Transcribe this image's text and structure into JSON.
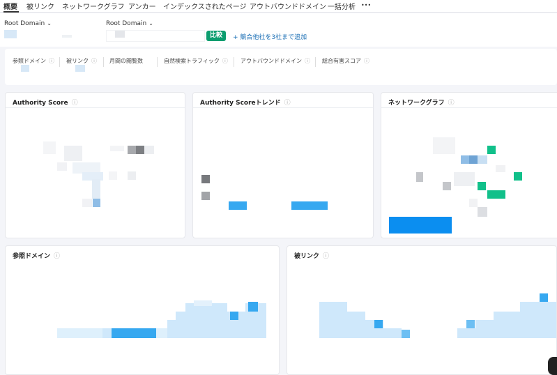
{
  "tabs": [
    "概要",
    "被リンク",
    "ネットワークグラフ",
    "アンカー",
    "インデックスされたページ",
    "アウトバウンドドメイン",
    "一括分析"
  ],
  "more_label": "•••",
  "domain_selector_1": {
    "label": "Root Domain"
  },
  "domain_selector_2": {
    "label": "Root Domain"
  },
  "compare_button": "比較",
  "add_competitors": "+ 競合他社を3社まで追加",
  "metrics": [
    "参照ドメイン",
    "被リンク",
    "月間の閲覧数",
    "自然検索トラフィック",
    "アウトバウンドドメイン",
    "総合有害スコア"
  ],
  "info_glyph": "ⓘ",
  "cards": {
    "authority_score": "Authority Score",
    "authority_trend": "Authority Scoreトレンド",
    "network_graph": "ネットワークグラフ",
    "referring_domains": "参照ドメイン",
    "backlinks": "被リンク"
  },
  "colors": {
    "accent_green": "#0c9d6f",
    "link_blue": "#1b6fb5",
    "chart_blue": "#36a8f0",
    "chart_light_blue": "#cfe8fb",
    "graph_green": "#11c08a"
  }
}
